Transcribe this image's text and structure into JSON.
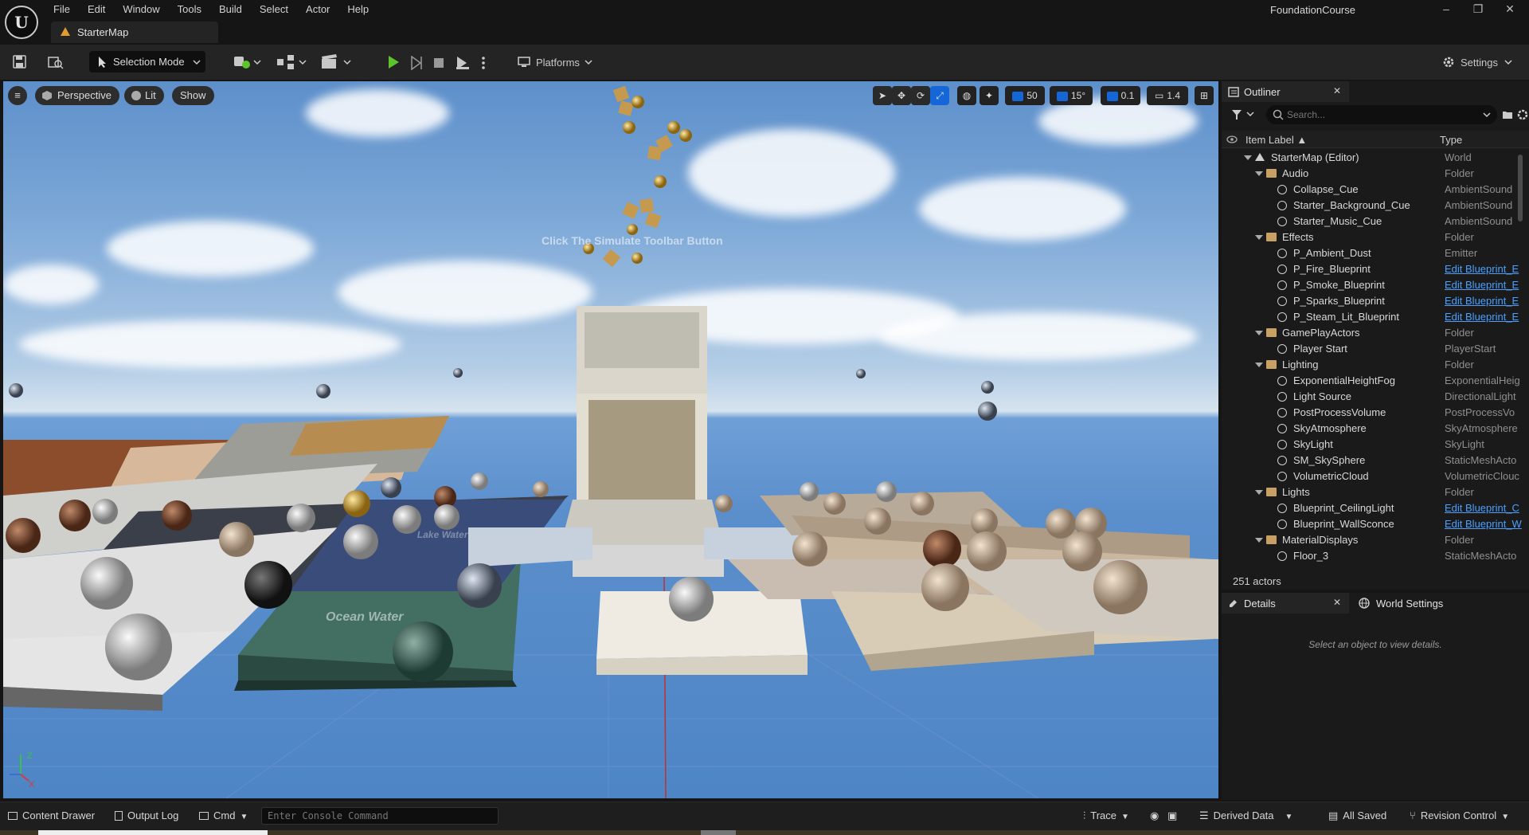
{
  "app": {
    "logo": "U",
    "project_name": "FoundationCourse",
    "document_tab": "StarterMap",
    "menus": [
      "File",
      "Edit",
      "Window",
      "Tools",
      "Build",
      "Select",
      "Actor",
      "Help"
    ],
    "window_controls": {
      "minimize": "–",
      "restore": "❐",
      "close": "✕"
    }
  },
  "toolbar": {
    "selection_mode": "Selection Mode",
    "platforms": "Platforms",
    "settings": "Settings"
  },
  "viewport": {
    "menu_icon": "≡",
    "perspective": "Perspective",
    "lit": "Lit",
    "show": "Show",
    "overlay_text": "Click The Simulate Toolbar Button",
    "grid_snap": "50",
    "rotation_snap": "15°",
    "scale_snap": "0.1",
    "camera_speed": "1.4",
    "floor_labels": [
      "Lake Water",
      "Ocean Water"
    ]
  },
  "outliner": {
    "title": "Outliner",
    "search_placeholder": "Search...",
    "col_label": "Item Label ▲",
    "col_type": "Type",
    "rows": [
      {
        "label": "StarterMap (Editor)",
        "type": "World",
        "depth": 0,
        "expand": true,
        "kind": "world"
      },
      {
        "label": "Audio",
        "type": "Folder",
        "depth": 1,
        "expand": true,
        "kind": "folder"
      },
      {
        "label": "Collapse_Cue",
        "type": "AmbientSound",
        "depth": 2,
        "kind": "sound"
      },
      {
        "label": "Starter_Background_Cue",
        "type": "AmbientSound",
        "depth": 2,
        "kind": "sound"
      },
      {
        "label": "Starter_Music_Cue",
        "type": "AmbientSound",
        "depth": 2,
        "kind": "sound"
      },
      {
        "label": "Effects",
        "type": "Folder",
        "depth": 1,
        "expand": true,
        "kind": "folder"
      },
      {
        "label": "P_Ambient_Dust",
        "type": "Emitter",
        "depth": 2,
        "kind": "emitter"
      },
      {
        "label": "P_Fire_Blueprint",
        "type": "Edit Blueprint_E",
        "depth": 2,
        "link": true,
        "kind": "actor"
      },
      {
        "label": "P_Smoke_Blueprint",
        "type": "Edit Blueprint_E",
        "depth": 2,
        "link": true,
        "kind": "actor"
      },
      {
        "label": "P_Sparks_Blueprint",
        "type": "Edit Blueprint_E",
        "depth": 2,
        "link": true,
        "kind": "actor"
      },
      {
        "label": "P_Steam_Lit_Blueprint",
        "type": "Edit Blueprint_E",
        "depth": 2,
        "link": true,
        "kind": "actor"
      },
      {
        "label": "GamePlayActors",
        "type": "Folder",
        "depth": 1,
        "expand": true,
        "kind": "folder"
      },
      {
        "label": "Player Start",
        "type": "PlayerStart",
        "depth": 2,
        "kind": "player"
      },
      {
        "label": "Lighting",
        "type": "Folder",
        "depth": 1,
        "expand": true,
        "kind": "folder"
      },
      {
        "label": "ExponentialHeightFog",
        "type": "ExponentialHeig",
        "depth": 2,
        "kind": "fog"
      },
      {
        "label": "Light Source",
        "type": "DirectionalLight",
        "depth": 2,
        "kind": "light"
      },
      {
        "label": "PostProcessVolume",
        "type": "PostProcessVo",
        "depth": 2,
        "kind": "volume"
      },
      {
        "label": "SkyAtmosphere",
        "type": "SkyAtmosphere",
        "depth": 2,
        "kind": "sky"
      },
      {
        "label": "SkyLight",
        "type": "SkyLight",
        "depth": 2,
        "kind": "skylight"
      },
      {
        "label": "SM_SkySphere",
        "type": "StaticMeshActo",
        "depth": 2,
        "kind": "mesh"
      },
      {
        "label": "VolumetricCloud",
        "type": "VolumetricClouc",
        "depth": 2,
        "kind": "cloud"
      },
      {
        "label": "Lights",
        "type": "Folder",
        "depth": 1,
        "expand": true,
        "kind": "folder"
      },
      {
        "label": "Blueprint_CeilingLight",
        "type": "Edit Blueprint_C",
        "depth": 2,
        "link": true,
        "kind": "actor"
      },
      {
        "label": "Blueprint_WallSconce",
        "type": "Edit Blueprint_W",
        "depth": 2,
        "link": true,
        "kind": "actor"
      },
      {
        "label": "MaterialDisplays",
        "type": "Folder",
        "depth": 1,
        "expand": true,
        "kind": "folder"
      },
      {
        "label": "Floor_3",
        "type": "StaticMeshActo",
        "depth": 2,
        "kind": "mesh"
      }
    ],
    "actor_count": "251 actors"
  },
  "details": {
    "tab_details": "Details",
    "tab_world_settings": "World Settings",
    "empty_message": "Select an object to view details."
  },
  "statusbar": {
    "content_drawer": "Content Drawer",
    "output_log": "Output Log",
    "cmd": "Cmd",
    "console_placeholder": "Enter Console Command",
    "trace": "Trace",
    "derived_data": "Derived Data",
    "all_saved": "All Saved",
    "revision_control": "Revision Control"
  },
  "colors": {
    "accent_blue": "#1566d6",
    "play_green": "#5ec42c",
    "link_blue": "#4aa0ff",
    "folder": "#c8a063"
  }
}
